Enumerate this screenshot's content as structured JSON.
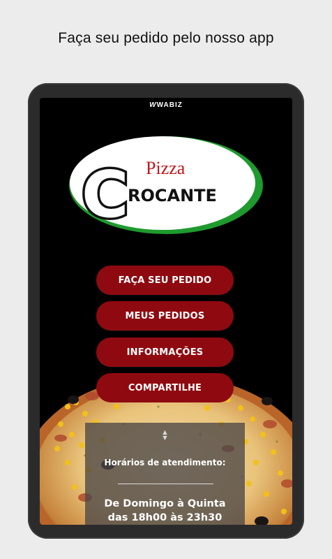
{
  "headline": "Faça seu pedido pelo nosso app",
  "device": {
    "brand": "WABIZ",
    "logo": {
      "word_small": "Pizza",
      "letter_big": "C",
      "word_big": "ROCANTE",
      "colors": {
        "ring": "#1f9a2e",
        "red": "#c4161c",
        "black": "#111111"
      }
    }
  },
  "menu": {
    "buttons": [
      {
        "label": "FAÇA SEU PEDIDO"
      },
      {
        "label": "MEUS PEDIDOS"
      },
      {
        "label": "INFORMAÇÕES"
      },
      {
        "label": "COMPARTILHE"
      }
    ],
    "accent": "#8f0a10"
  },
  "hours": {
    "icon": "chevron-updown-icon",
    "label": "Horários de atendimento:",
    "days": "De Domingo à Quinta",
    "time": "das 18h00 às 23h30"
  }
}
